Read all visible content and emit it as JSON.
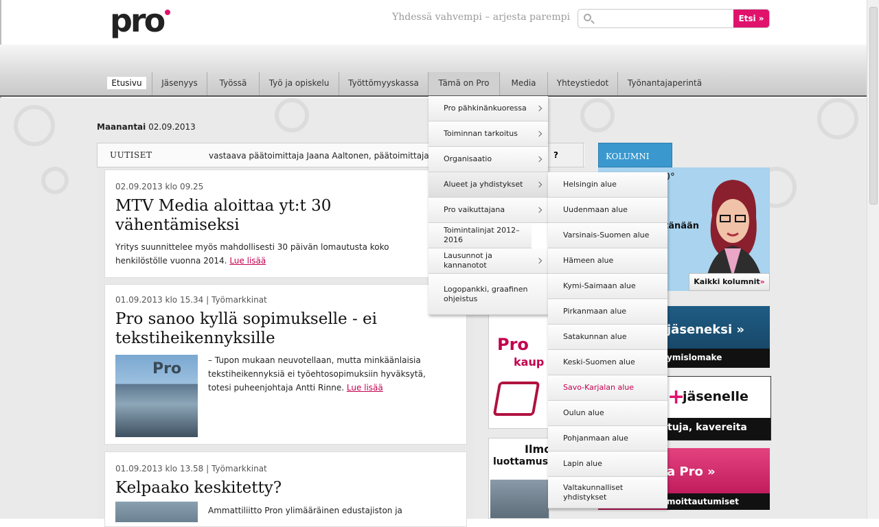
{
  "header": {
    "logo_text": "pro",
    "tagline": "Yhdessä vahvempi – arjesta parempi",
    "search_placeholder": "",
    "search_button": "Etsi »"
  },
  "nav": {
    "items": [
      "Etusivu",
      "Jäsenyys",
      "Työssä",
      "Työ ja opiskelu",
      "Työttömyyskassa",
      "Tämä on Pro",
      "Media",
      "Yhteystiedot",
      "Työnantajaperintä"
    ],
    "active": "Etusivu"
  },
  "date": {
    "day": "Maanantai",
    "value": "02.09.2013"
  },
  "news": {
    "label": "UUTISET",
    "ticker": "vastaava päätoimittaja Jaana Aaltonen, päätoimittaja Ka",
    "articles": [
      {
        "meta": "02.09.2013 klo 09.25",
        "title": "MTV Media aloittaa yt:t 30 vähentämiseksi",
        "body": "Yritys suunnittelee myös mahdollisesti 30 päivän lomautusta koko henkilöstölle vuonna 2014.",
        "more": "Lue lisää"
      },
      {
        "meta": "01.09.2013 klo 15.34 | Työmarkkinat",
        "title": "Pro sanoo kyllä sopimukselle - ei tekstiheikennyksille",
        "body": "– Tupon mukaan neuvotellaan, mutta minkäänlaisia tekstiheikennyksiä ei työehtosopimuksiin hyväksytä, totesi puheenjohtaja Antti Rinne.",
        "more": "Lue lisää",
        "image_label": "Pro"
      },
      {
        "meta": "01.09.2013 klo 13.58 | Työmarkkinat",
        "title": "Kelpaako keskitetty?",
        "body": "Ammattiliitto Pron ylimääräinen edustajiston ja"
      }
    ]
  },
  "middle": {
    "header_fragment": "?",
    "ad1": {
      "line1": "Pro",
      "line2": "kaup"
    },
    "ad2": {
      "line1": "Ilmoit",
      "line2": "luottamuste"
    }
  },
  "right": {
    "kolumni": "KOLUMNI",
    "kol_deg": "0°",
    "kol_tanaan": "tänään",
    "all_columns": "Kaikki kolumnit",
    "banner1": {
      "title": "jäseneksi »",
      "sub": "ymislomake"
    },
    "banner2": {
      "plus": "+",
      "title": "jäsenelle",
      "sub": "tuja, kavereita"
    },
    "banner3": {
      "title": "a Pro »",
      "sub": "moittautumiset"
    }
  },
  "dropdown_main": [
    {
      "label": "Pro pähkinänkuoressa",
      "sub": true
    },
    {
      "label": "Toiminnan tarkoitus",
      "sub": true
    },
    {
      "label": "Organisaatio",
      "sub": true
    },
    {
      "label": "Alueet ja yhdistykset",
      "sub": true
    },
    {
      "label": "Pro vaikuttajana",
      "sub": true
    },
    {
      "label": "Toimintalinjat 2012–2016",
      "sub": false
    },
    {
      "label": "Lausunnot ja kannanotot",
      "sub": true
    },
    {
      "label": "Logopankki, graafinen ohjeistus",
      "sub": false
    }
  ],
  "dropdown_sub": [
    {
      "label": "Helsingin alue"
    },
    {
      "label": "Uudenmaan alue"
    },
    {
      "label": "Varsinais-Suomen alue"
    },
    {
      "label": "Hämeen alue"
    },
    {
      "label": "Kymi-Saimaan alue"
    },
    {
      "label": "Pirkanmaan alue"
    },
    {
      "label": "Satakunnan alue"
    },
    {
      "label": "Keski-Suomen alue"
    },
    {
      "label": "Savo-Karjalan alue",
      "hover": true
    },
    {
      "label": "Oulun alue"
    },
    {
      "label": "Pohjanmaan alue"
    },
    {
      "label": "Lapin alue"
    },
    {
      "label": "Valtakunnalliset yhdistykset"
    }
  ],
  "colors": {
    "accent": "#e0126b",
    "link": "#c3004f",
    "kolumni": "#3a98cf"
  }
}
